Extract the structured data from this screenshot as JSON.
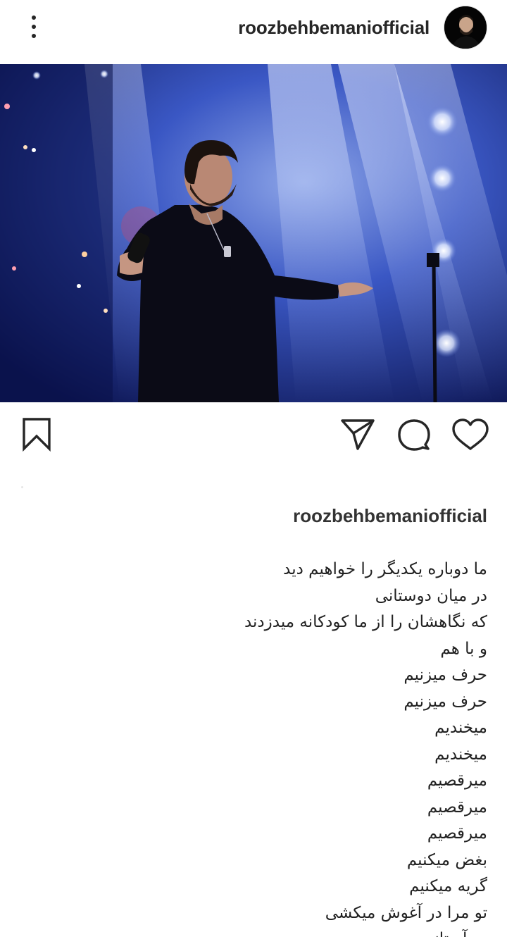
{
  "header": {
    "username": "roozbehbemaniofficial",
    "more_icon": "more-vertical-icon"
  },
  "post": {
    "image_description_icon": "photo"
  },
  "actions": {
    "save_icon": "bookmark-icon",
    "share_icon": "send-icon",
    "comment_icon": "comment-icon",
    "like_icon": "heart-icon"
  },
  "caption": {
    "username": "roozbehbemaniofficial",
    "lines": [
      "ما دوباره یکدیگر را خواهیم دید",
      "در میان دوستانی",
      " که نگاهشان را از ما کودکانه میدزدند",
      "و با هم",
      "حرف میزنیم",
      "حرف میزنیم",
      "میخندیم",
      "میخندیم",
      "میرقصیم",
      "میرقصیم",
      "میرقصیم",
      "بغض میکنیم",
      "گریه میکنیم",
      "تو مرا در آغوش میکشی",
      "در آستانه‌ی در"
    ]
  },
  "colors": {
    "text": "#262626",
    "stage_blue": "#1c2c8c",
    "background": "#ffffff"
  }
}
